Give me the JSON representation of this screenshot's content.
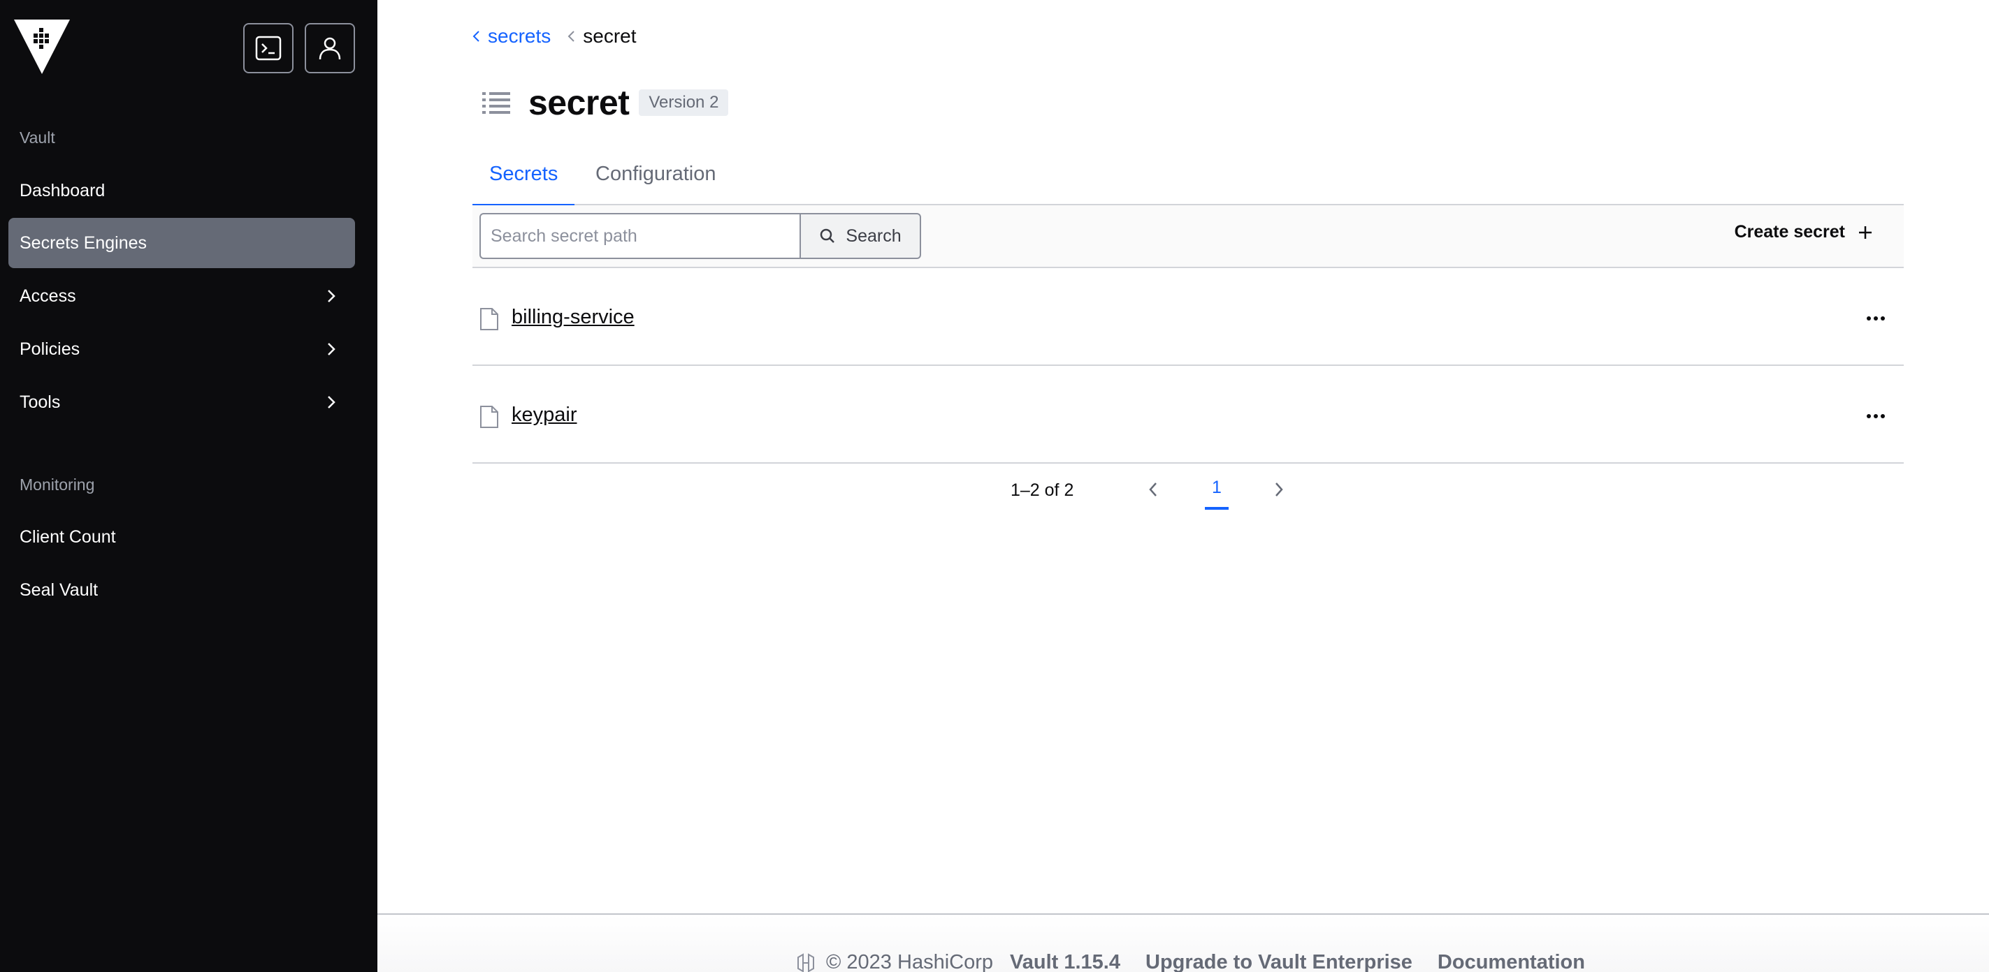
{
  "sidebar": {
    "logo_icon": "vault-logo-icon",
    "console_icon": "terminal-icon",
    "user_icon": "user-icon",
    "sections": [
      {
        "heading": "Vault"
      },
      {
        "heading": "Monitoring"
      }
    ],
    "items": [
      {
        "label": "Dashboard",
        "active": false,
        "has_chevron": false
      },
      {
        "label": "Secrets Engines",
        "active": true,
        "has_chevron": false
      },
      {
        "label": "Access",
        "active": false,
        "has_chevron": true
      },
      {
        "label": "Policies",
        "active": false,
        "has_chevron": true
      },
      {
        "label": "Tools",
        "active": false,
        "has_chevron": true
      },
      {
        "label": "Client Count",
        "active": false,
        "has_chevron": false
      },
      {
        "label": "Seal Vault",
        "active": false,
        "has_chevron": false
      }
    ]
  },
  "breadcrumb": {
    "parent": "secrets",
    "current": "secret"
  },
  "header": {
    "title": "secret",
    "version_badge": "Version 2",
    "icon": "list-icon"
  },
  "tabs": [
    {
      "label": "Secrets",
      "active": true
    },
    {
      "label": "Configuration",
      "active": false
    }
  ],
  "toolbar": {
    "search_placeholder": "Search secret path",
    "search_value": "",
    "search_button": "Search",
    "create_button": "Create secret"
  },
  "secrets": [
    {
      "name": "billing-service"
    },
    {
      "name": "keypair"
    }
  ],
  "pagination": {
    "info": "1–2 of 2",
    "current_page": "1"
  },
  "footer": {
    "copyright": "© 2023 HashiCorp",
    "version": "Vault 1.15.4",
    "upgrade_link": "Upgrade to Vault Enterprise",
    "docs_link": "Documentation"
  },
  "colors": {
    "sidebar_bg": "#0c0c0e",
    "active_nav": "#656a76",
    "accent": "#1563ff"
  }
}
